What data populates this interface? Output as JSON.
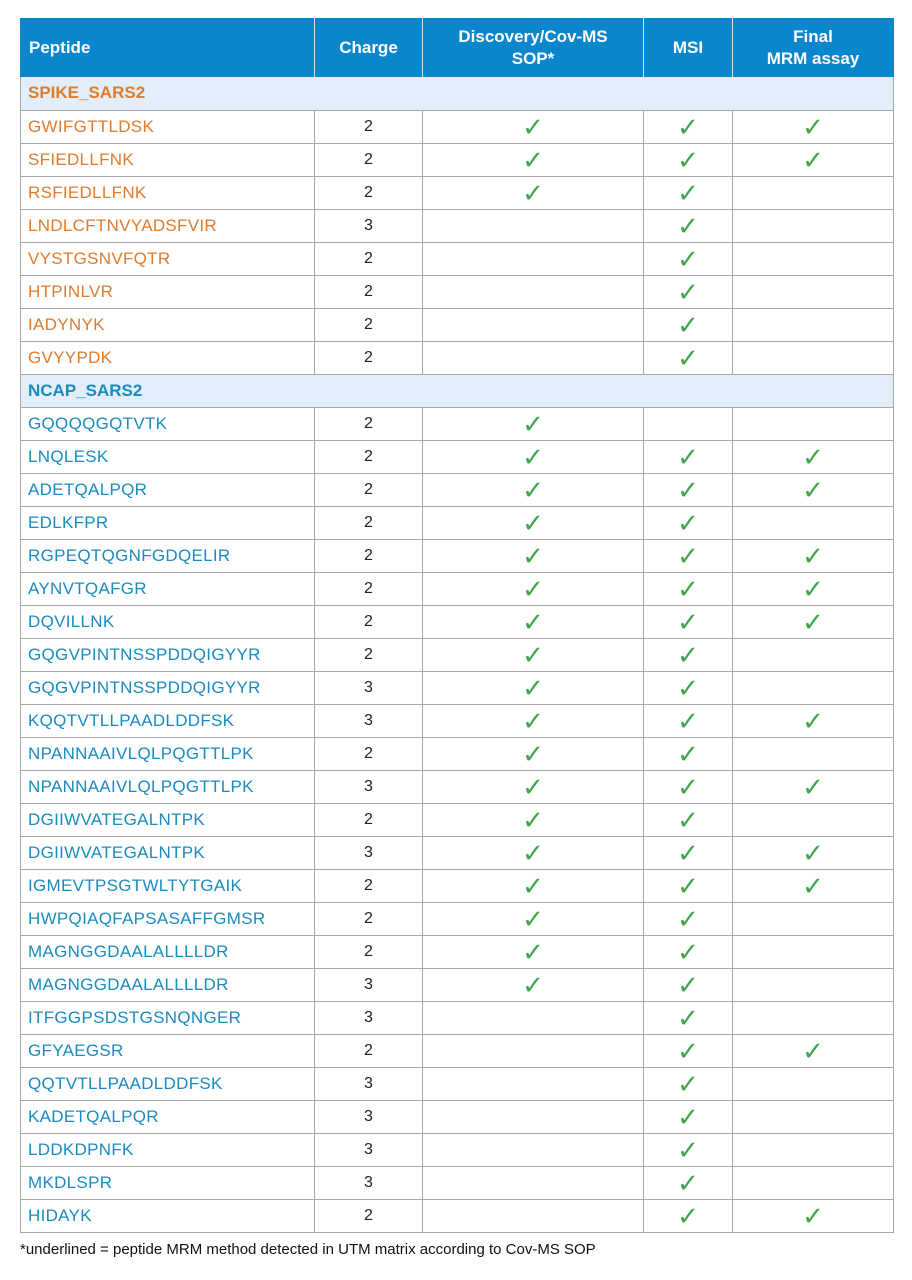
{
  "table": {
    "headers": {
      "peptide": "Peptide",
      "charge": "Charge",
      "discovery": "Discovery/Cov-MS SOP*",
      "discovery_line1": "Discovery/Cov-MS",
      "discovery_line2": "SOP*",
      "msi": "MSI",
      "final": "Final MRM assay",
      "final_line1": "Final",
      "final_line2": "MRM assay"
    },
    "check_icon": "check-mark-icon",
    "check_glyph": "✓",
    "colors": {
      "header_bg": "#0a87cc",
      "section_bg": "#e2eef9",
      "spike_text": "#e07b2c",
      "ncap_text": "#1a8bbf",
      "check": "#3fa64a"
    },
    "sections": [
      {
        "name": "SPIKE_SARS2",
        "key": "spike",
        "rows": [
          {
            "peptide": "GWIFGTTLDSK",
            "charge": "2",
            "discovery": true,
            "msi": true,
            "final": true
          },
          {
            "peptide": "SFIEDLLFNK",
            "charge": "2",
            "discovery": true,
            "msi": true,
            "final": true
          },
          {
            "peptide": "RSFIEDLLFNK",
            "charge": "2",
            "discovery": true,
            "msi": true,
            "final": false
          },
          {
            "peptide": "LNDLCFTNVYADSFVIR",
            "charge": "3",
            "discovery": false,
            "msi": true,
            "final": false
          },
          {
            "peptide": "VYSTGSNVFQTR",
            "charge": "2",
            "discovery": false,
            "msi": true,
            "final": false
          },
          {
            "peptide": "HTPINLVR",
            "charge": "2",
            "discovery": false,
            "msi": true,
            "final": false
          },
          {
            "peptide": "IADYNYK",
            "charge": "2",
            "discovery": false,
            "msi": true,
            "final": false
          },
          {
            "peptide": "GVYYPDK",
            "charge": "2",
            "discovery": false,
            "msi": true,
            "final": false
          }
        ]
      },
      {
        "name": "NCAP_SARS2",
        "key": "ncap",
        "rows": [
          {
            "peptide": "GQQQQGQTVTK",
            "charge": "2",
            "discovery": true,
            "msi": false,
            "final": false
          },
          {
            "peptide": "LNQLESK",
            "charge": "2",
            "discovery": true,
            "msi": true,
            "final": true
          },
          {
            "peptide": "ADETQALPQR",
            "charge": "2",
            "discovery": true,
            "msi": true,
            "final": true
          },
          {
            "peptide": "EDLKFPR",
            "charge": "2",
            "discovery": true,
            "msi": true,
            "final": false
          },
          {
            "peptide": "RGPEQTQGNFGDQELIR",
            "charge": "2",
            "discovery": true,
            "msi": true,
            "final": true
          },
          {
            "peptide": "AYNVTQAFGR",
            "charge": "2",
            "discovery": true,
            "msi": true,
            "final": true
          },
          {
            "peptide": "DQVILLNK",
            "charge": "2",
            "discovery": true,
            "msi": true,
            "final": true
          },
          {
            "peptide": "GQGVPINTNSSPDDQIGYYR",
            "charge": "2",
            "discovery": true,
            "msi": true,
            "final": false
          },
          {
            "peptide": "GQGVPINTNSSPDDQIGYYR",
            "charge": "3",
            "discovery": true,
            "msi": true,
            "final": false
          },
          {
            "peptide": "KQQTVTLLPAADLDDFSK",
            "charge": "3",
            "discovery": true,
            "msi": true,
            "final": true
          },
          {
            "peptide": "NPANNAAIVLQLPQGTTLPK",
            "charge": "2",
            "discovery": true,
            "msi": true,
            "final": false
          },
          {
            "peptide": "NPANNAAIVLQLPQGTTLPK",
            "charge": "3",
            "discovery": true,
            "msi": true,
            "final": true
          },
          {
            "peptide": "DGIIWVATEGALNTPK",
            "charge": "2",
            "discovery": true,
            "msi": true,
            "final": false
          },
          {
            "peptide": "DGIIWVATEGALNTPK",
            "charge": "3",
            "discovery": true,
            "msi": true,
            "final": true
          },
          {
            "peptide": "IGMEVTPSGTWLTYTGAIK",
            "charge": "2",
            "discovery": true,
            "msi": true,
            "final": true
          },
          {
            "peptide": "HWPQIAQFAPSASAFFGMSR",
            "charge": "2",
            "discovery": true,
            "msi": true,
            "final": false
          },
          {
            "peptide": "MAGNGGDAALALLLLDR",
            "charge": "2",
            "discovery": true,
            "msi": true,
            "final": false
          },
          {
            "peptide": "MAGNGGDAALALLLLDR",
            "charge": "3",
            "discovery": true,
            "msi": true,
            "final": false
          },
          {
            "peptide": "ITFGGPSDSTGSNQNGER",
            "charge": "3",
            "discovery": false,
            "msi": true,
            "final": false
          },
          {
            "peptide": "GFYAEGSR",
            "charge": "2",
            "discovery": false,
            "msi": true,
            "final": true
          },
          {
            "peptide": "QQTVTLLPAADLDDFSK",
            "charge": "3",
            "discovery": false,
            "msi": true,
            "final": false
          },
          {
            "peptide": "KADETQALPQR",
            "charge": "3",
            "discovery": false,
            "msi": true,
            "final": false
          },
          {
            "peptide": "LDDKDPNFK",
            "charge": "3",
            "discovery": false,
            "msi": true,
            "final": false
          },
          {
            "peptide": "MKDLSPR",
            "charge": "3",
            "discovery": false,
            "msi": true,
            "final": false
          },
          {
            "peptide": "HIDAYK",
            "charge": "2",
            "discovery": false,
            "msi": true,
            "final": true
          }
        ]
      }
    ]
  },
  "footnote": "*underlined = peptide MRM method detected in UTM matrix according to Cov-MS SOP"
}
